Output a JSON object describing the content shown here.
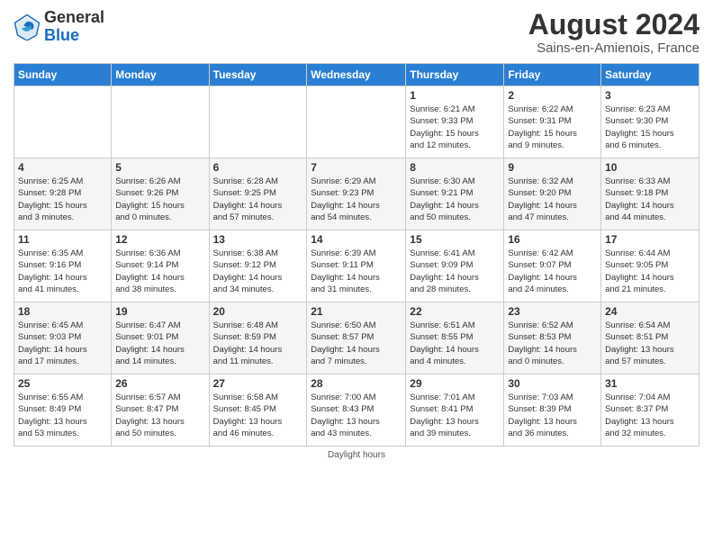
{
  "header": {
    "logo_general": "General",
    "logo_blue": "Blue",
    "month_title": "August 2024",
    "location": "Sains-en-Amienois, France"
  },
  "columns": [
    "Sunday",
    "Monday",
    "Tuesday",
    "Wednesday",
    "Thursday",
    "Friday",
    "Saturday"
  ],
  "weeks": [
    [
      {
        "day": "",
        "info": ""
      },
      {
        "day": "",
        "info": ""
      },
      {
        "day": "",
        "info": ""
      },
      {
        "day": "",
        "info": ""
      },
      {
        "day": "1",
        "info": "Sunrise: 6:21 AM\nSunset: 9:33 PM\nDaylight: 15 hours\nand 12 minutes."
      },
      {
        "day": "2",
        "info": "Sunrise: 6:22 AM\nSunset: 9:31 PM\nDaylight: 15 hours\nand 9 minutes."
      },
      {
        "day": "3",
        "info": "Sunrise: 6:23 AM\nSunset: 9:30 PM\nDaylight: 15 hours\nand 6 minutes."
      }
    ],
    [
      {
        "day": "4",
        "info": "Sunrise: 6:25 AM\nSunset: 9:28 PM\nDaylight: 15 hours\nand 3 minutes."
      },
      {
        "day": "5",
        "info": "Sunrise: 6:26 AM\nSunset: 9:26 PM\nDaylight: 15 hours\nand 0 minutes."
      },
      {
        "day": "6",
        "info": "Sunrise: 6:28 AM\nSunset: 9:25 PM\nDaylight: 14 hours\nand 57 minutes."
      },
      {
        "day": "7",
        "info": "Sunrise: 6:29 AM\nSunset: 9:23 PM\nDaylight: 14 hours\nand 54 minutes."
      },
      {
        "day": "8",
        "info": "Sunrise: 6:30 AM\nSunset: 9:21 PM\nDaylight: 14 hours\nand 50 minutes."
      },
      {
        "day": "9",
        "info": "Sunrise: 6:32 AM\nSunset: 9:20 PM\nDaylight: 14 hours\nand 47 minutes."
      },
      {
        "day": "10",
        "info": "Sunrise: 6:33 AM\nSunset: 9:18 PM\nDaylight: 14 hours\nand 44 minutes."
      }
    ],
    [
      {
        "day": "11",
        "info": "Sunrise: 6:35 AM\nSunset: 9:16 PM\nDaylight: 14 hours\nand 41 minutes."
      },
      {
        "day": "12",
        "info": "Sunrise: 6:36 AM\nSunset: 9:14 PM\nDaylight: 14 hours\nand 38 minutes."
      },
      {
        "day": "13",
        "info": "Sunrise: 6:38 AM\nSunset: 9:12 PM\nDaylight: 14 hours\nand 34 minutes."
      },
      {
        "day": "14",
        "info": "Sunrise: 6:39 AM\nSunset: 9:11 PM\nDaylight: 14 hours\nand 31 minutes."
      },
      {
        "day": "15",
        "info": "Sunrise: 6:41 AM\nSunset: 9:09 PM\nDaylight: 14 hours\nand 28 minutes."
      },
      {
        "day": "16",
        "info": "Sunrise: 6:42 AM\nSunset: 9:07 PM\nDaylight: 14 hours\nand 24 minutes."
      },
      {
        "day": "17",
        "info": "Sunrise: 6:44 AM\nSunset: 9:05 PM\nDaylight: 14 hours\nand 21 minutes."
      }
    ],
    [
      {
        "day": "18",
        "info": "Sunrise: 6:45 AM\nSunset: 9:03 PM\nDaylight: 14 hours\nand 17 minutes."
      },
      {
        "day": "19",
        "info": "Sunrise: 6:47 AM\nSunset: 9:01 PM\nDaylight: 14 hours\nand 14 minutes."
      },
      {
        "day": "20",
        "info": "Sunrise: 6:48 AM\nSunset: 8:59 PM\nDaylight: 14 hours\nand 11 minutes."
      },
      {
        "day": "21",
        "info": "Sunrise: 6:50 AM\nSunset: 8:57 PM\nDaylight: 14 hours\nand 7 minutes."
      },
      {
        "day": "22",
        "info": "Sunrise: 6:51 AM\nSunset: 8:55 PM\nDaylight: 14 hours\nand 4 minutes."
      },
      {
        "day": "23",
        "info": "Sunrise: 6:52 AM\nSunset: 8:53 PM\nDaylight: 14 hours\nand 0 minutes."
      },
      {
        "day": "24",
        "info": "Sunrise: 6:54 AM\nSunset: 8:51 PM\nDaylight: 13 hours\nand 57 minutes."
      }
    ],
    [
      {
        "day": "25",
        "info": "Sunrise: 6:55 AM\nSunset: 8:49 PM\nDaylight: 13 hours\nand 53 minutes."
      },
      {
        "day": "26",
        "info": "Sunrise: 6:57 AM\nSunset: 8:47 PM\nDaylight: 13 hours\nand 50 minutes."
      },
      {
        "day": "27",
        "info": "Sunrise: 6:58 AM\nSunset: 8:45 PM\nDaylight: 13 hours\nand 46 minutes."
      },
      {
        "day": "28",
        "info": "Sunrise: 7:00 AM\nSunset: 8:43 PM\nDaylight: 13 hours\nand 43 minutes."
      },
      {
        "day": "29",
        "info": "Sunrise: 7:01 AM\nSunset: 8:41 PM\nDaylight: 13 hours\nand 39 minutes."
      },
      {
        "day": "30",
        "info": "Sunrise: 7:03 AM\nSunset: 8:39 PM\nDaylight: 13 hours\nand 36 minutes."
      },
      {
        "day": "31",
        "info": "Sunrise: 7:04 AM\nSunset: 8:37 PM\nDaylight: 13 hours\nand 32 minutes."
      }
    ]
  ],
  "footer": {
    "daylight_label": "Daylight hours"
  }
}
